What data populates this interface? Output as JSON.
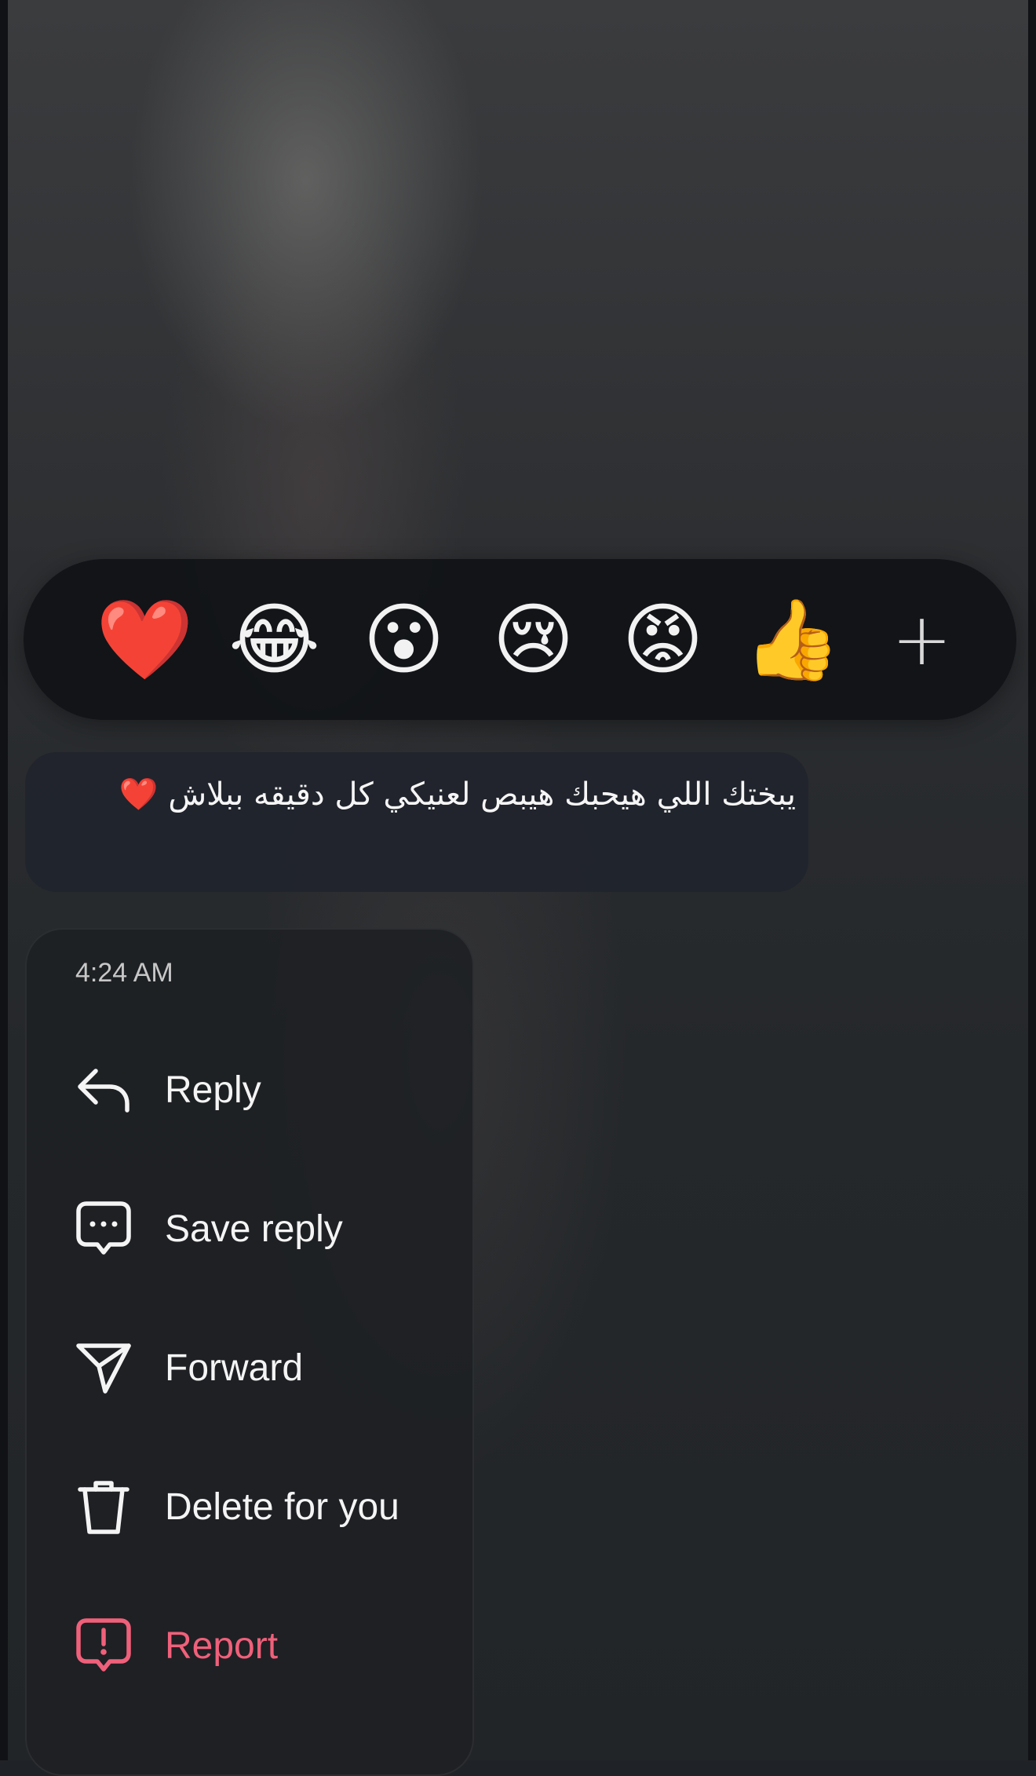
{
  "reactions": {
    "items": [
      {
        "emoji": "❤️",
        "name": "heart"
      },
      {
        "emoji": "😂",
        "name": "laughing"
      },
      {
        "emoji": "😮",
        "name": "surprised"
      },
      {
        "emoji": "😢",
        "name": "crying"
      },
      {
        "emoji": "😡",
        "name": "angry"
      },
      {
        "emoji": "👍",
        "name": "thumbs-up"
      }
    ],
    "more": "+"
  },
  "message": {
    "text": "يبختك اللي هيحبك هيبص لعنيكي كل دقيقه ببلاش ❤️"
  },
  "menu": {
    "time": "4:24 AM",
    "items": [
      {
        "label": "Reply",
        "icon": "reply-icon"
      },
      {
        "label": "Save reply",
        "icon": "chat-bubble-dots-icon"
      },
      {
        "label": "Forward",
        "icon": "send-icon"
      },
      {
        "label": "Delete for you",
        "icon": "trash-icon"
      },
      {
        "label": "Report",
        "icon": "report-icon",
        "color": "#f0607a"
      }
    ]
  }
}
